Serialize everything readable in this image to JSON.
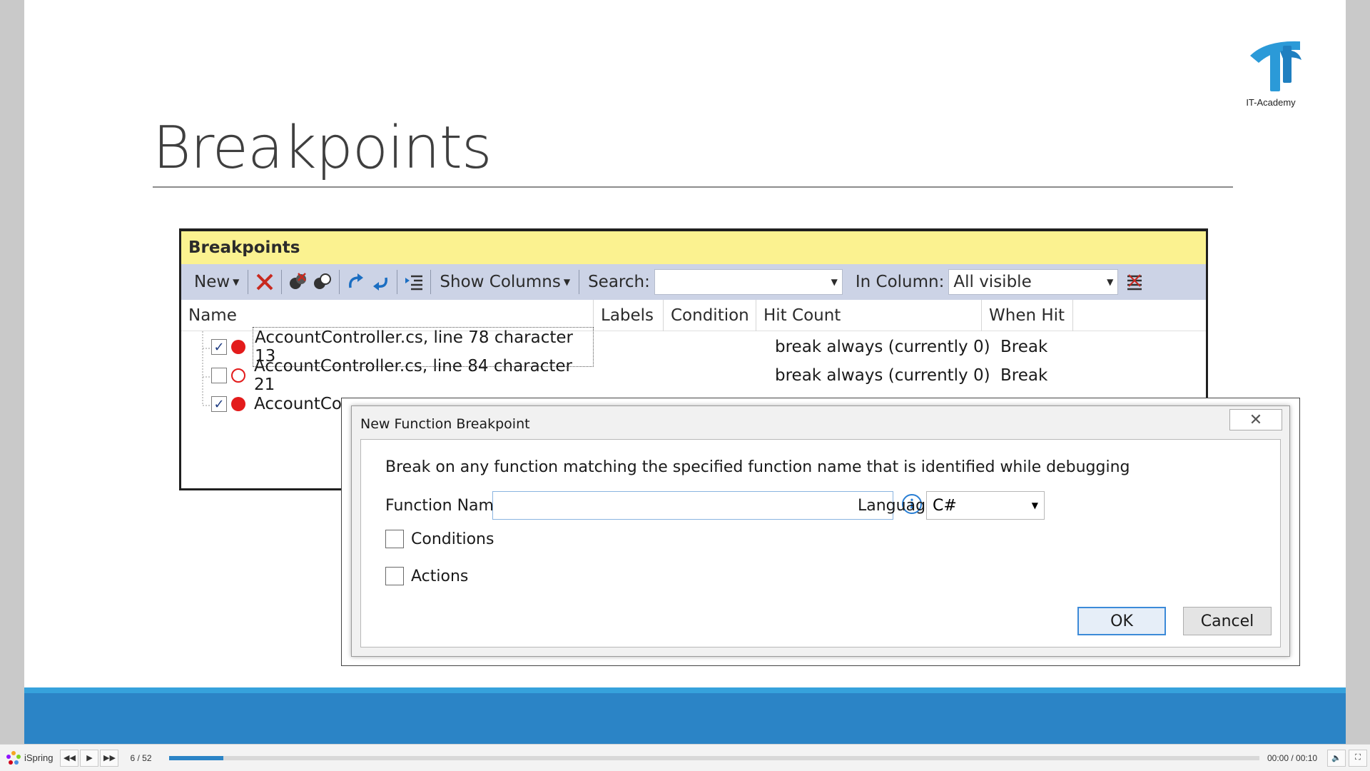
{
  "slide": {
    "title": "Breakpoints",
    "logo_text": "IT-Academy",
    "colors": {
      "accent_blue": "#2b84c6",
      "header_yellow": "#fbf290",
      "breakpoint_red": "#e31b1b"
    }
  },
  "panel": {
    "header": "Breakpoints",
    "toolbar": {
      "new_label": "New",
      "show_columns_label": "Show Columns",
      "search_label": "Search:",
      "search_value": "",
      "in_column_label": "In Column:",
      "in_column_value": "All visible"
    },
    "columns": [
      "Name",
      "Labels",
      "Condition",
      "Hit Count",
      "When Hit"
    ],
    "rows": [
      {
        "checked": true,
        "enabled": true,
        "name": "AccountController.cs, line 78 character 13",
        "hit_count": "break always (currently 0)",
        "when_hit": "Break"
      },
      {
        "checked": false,
        "enabled": false,
        "name": "AccountController.cs, line 84 character 21",
        "hit_count": "break always (currently 0)",
        "when_hit": "Break"
      },
      {
        "checked": true,
        "enabled": true,
        "name": "AccountCo",
        "hit_count": "",
        "when_hit": ""
      }
    ]
  },
  "dialog": {
    "title": "New Function Breakpoint",
    "description": "Break on any function matching the specified function name that is identified while debugging",
    "function_name_label": "Function Name:",
    "function_name_value": "",
    "language_label": "Language:",
    "language_value": "C#",
    "conditions_label": "Conditions",
    "actions_label": "Actions",
    "ok_label": "OK",
    "cancel_label": "Cancel"
  },
  "player": {
    "brand": "iSpring",
    "slide_counter": "6 / 52",
    "time": "00:00 / 00:10",
    "progress_percent": 5
  }
}
